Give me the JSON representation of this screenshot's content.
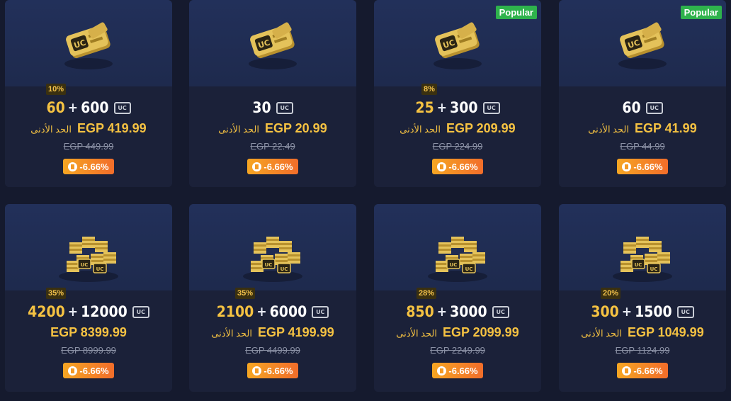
{
  "currency_icon": "uc-icon",
  "min_label": "الحد الأدنى",
  "popular_label": "Popular",
  "cards": [
    {
      "bonus_pct": "10%",
      "bonus": "60",
      "plus": "+",
      "base": "600",
      "price": "EGP 419.99",
      "old_price": "EGP 449.99",
      "discount": "-6.66%",
      "popular": false,
      "show_min": true
    },
    {
      "bonus_pct": "",
      "bonus": "",
      "plus": "",
      "base": "30",
      "price": "EGP 20.99",
      "old_price": "EGP 22.49",
      "discount": "-6.66%",
      "popular": false,
      "show_min": true
    },
    {
      "bonus_pct": "8%",
      "bonus": "25",
      "plus": "+",
      "base": "300",
      "price": "EGP 209.99",
      "old_price": "EGP 224.99",
      "discount": "-6.66%",
      "popular": true,
      "show_min": true
    },
    {
      "bonus_pct": "",
      "bonus": "",
      "plus": "",
      "base": "60",
      "price": "EGP 41.99",
      "old_price": "EGP 44.99",
      "discount": "-6.66%",
      "popular": true,
      "show_min": true
    },
    {
      "bonus_pct": "35%",
      "bonus": "4200",
      "plus": "+",
      "base": "12000",
      "price": "EGP 8399.99",
      "old_price": "EGP 8999.99",
      "discount": "-6.66%",
      "popular": false,
      "show_min": false
    },
    {
      "bonus_pct": "35%",
      "bonus": "2100",
      "plus": "+",
      "base": "6000",
      "price": "EGP 4199.99",
      "old_price": "EGP 4499.99",
      "discount": "-6.66%",
      "popular": false,
      "show_min": true
    },
    {
      "bonus_pct": "28%",
      "bonus": "850",
      "plus": "+",
      "base": "3000",
      "price": "EGP 2099.99",
      "old_price": "EGP 2249.99",
      "discount": "-6.66%",
      "popular": false,
      "show_min": true
    },
    {
      "bonus_pct": "20%",
      "bonus": "300",
      "plus": "+",
      "base": "1500",
      "price": "EGP 1049.99",
      "old_price": "EGP 1124.99",
      "discount": "-6.66%",
      "popular": false,
      "show_min": true
    }
  ]
}
